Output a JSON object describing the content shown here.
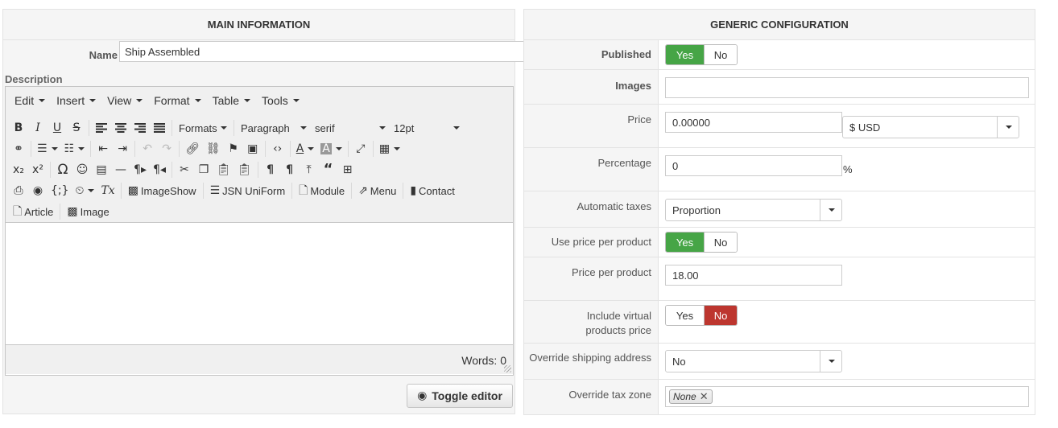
{
  "main_info": {
    "title": "MAIN INFORMATION",
    "name_label": "Name",
    "name_value": "Ship Assembled",
    "description_label": "Description"
  },
  "editor": {
    "menus": [
      "Edit",
      "Insert",
      "View",
      "Format",
      "Table",
      "Tools"
    ],
    "formats_label": "Formats",
    "paragraph_label": "Paragraph",
    "font_label": "serif",
    "size_label": "12pt",
    "plugins_row4": [
      "ImageShow",
      "JSN UniForm",
      "Module",
      "Menu",
      "Contact"
    ],
    "plugins_row5": [
      "Article",
      "Image"
    ],
    "words_label": "Words: 0",
    "toggle_label": "Toggle editor"
  },
  "generic": {
    "title": "GENERIC CONFIGURATION",
    "yes": "Yes",
    "no": "No",
    "published_label": "Published",
    "published": "Yes",
    "images_label": "Images",
    "price_label": "Price",
    "price_value": "0.00000",
    "currency": "$ USD",
    "percentage_label": "Percentage",
    "percentage_value": "0",
    "percent_sign": "%",
    "auto_taxes_label": "Automatic taxes",
    "auto_taxes_value": "Proportion",
    "use_ppp_label": "Use price per product",
    "use_ppp": "Yes",
    "ppp_label": "Price per product",
    "ppp_value": "18.00",
    "virtual_label_1": "Include virtual",
    "virtual_label_2": "products price",
    "virtual": "No",
    "override_ship_label": "Override shipping address",
    "override_ship_value": "No",
    "override_tax_label": "Override tax zone",
    "override_tax_chip": "None"
  },
  "colors": {
    "yes_active": "#46a546",
    "no_active": "#bd362f",
    "panel_bg": "#f5f5f5"
  }
}
